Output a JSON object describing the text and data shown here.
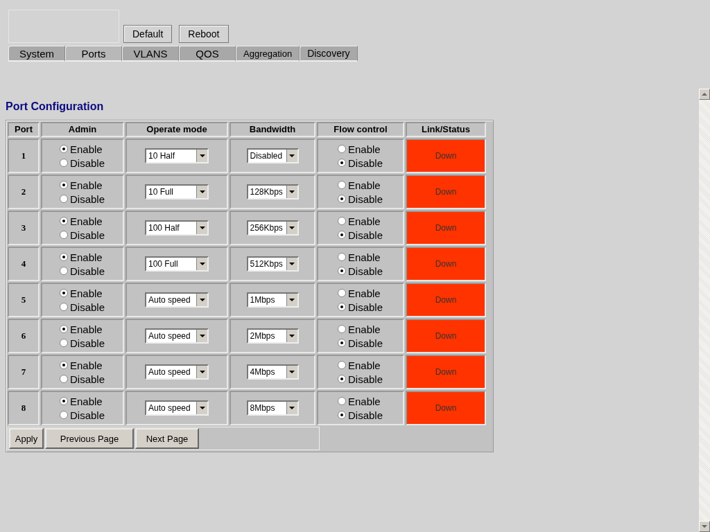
{
  "header": {
    "buttons": [
      "Default",
      "Reboot"
    ]
  },
  "tabs": [
    {
      "label": "System",
      "selected": false,
      "kind": "large"
    },
    {
      "label": "Ports",
      "selected": true,
      "kind": "large"
    },
    {
      "label": "VLANS",
      "selected": false,
      "kind": "large"
    },
    {
      "label": "QOS",
      "selected": false,
      "kind": "large"
    },
    {
      "label": "Aggregation",
      "selected": false,
      "kind": "small"
    },
    {
      "label": "Discovery",
      "selected": false,
      "kind": "medium"
    }
  ],
  "title": "Port Configuration",
  "table": {
    "columns": [
      "Port",
      "Admin",
      "Operate mode",
      "Bandwidth",
      "Flow control",
      "Link/Status"
    ],
    "rows": [
      {
        "port": "1",
        "admin": [
          {
            "label": "Enable",
            "selected": true
          },
          {
            "label": "Disable",
            "selected": false
          }
        ],
        "operate_mode": "10 Half",
        "bandwidth": "Disabled",
        "flow_control": [
          {
            "label": "Enable",
            "selected": false
          },
          {
            "label": "Disable",
            "selected": true
          }
        ],
        "link_status": "Down",
        "color": "#ff3300"
      },
      {
        "port": "2",
        "admin": [
          {
            "label": "Enable",
            "selected": true
          },
          {
            "label": "Disable",
            "selected": false
          }
        ],
        "operate_mode": "10 Full",
        "bandwidth": "128Kbps",
        "flow_control": [
          {
            "label": "Enable",
            "selected": false
          },
          {
            "label": "Disable",
            "selected": true
          }
        ],
        "link_status": "Down",
        "color": "#ff3300"
      },
      {
        "port": "3",
        "admin": [
          {
            "label": "Enable",
            "selected": true
          },
          {
            "label": "Disable",
            "selected": false
          }
        ],
        "operate_mode": "100 Half",
        "bandwidth": "256Kbps",
        "flow_control": [
          {
            "label": "Enable",
            "selected": false
          },
          {
            "label": "Disable",
            "selected": true
          }
        ],
        "link_status": "Down",
        "color": "#ff3300"
      },
      {
        "port": "4",
        "admin": [
          {
            "label": "Enable",
            "selected": true
          },
          {
            "label": "Disable",
            "selected": false
          }
        ],
        "operate_mode": "100 Full",
        "bandwidth": "512Kbps",
        "flow_control": [
          {
            "label": "Enable",
            "selected": false
          },
          {
            "label": "Disable",
            "selected": true
          }
        ],
        "link_status": "Down",
        "color": "#ff3300"
      },
      {
        "port": "5",
        "admin": [
          {
            "label": "Enable",
            "selected": true
          },
          {
            "label": "Disable",
            "selected": false
          }
        ],
        "operate_mode": "Auto speed",
        "bandwidth": "1Mbps",
        "flow_control": [
          {
            "label": "Enable",
            "selected": false
          },
          {
            "label": "Disable",
            "selected": true
          }
        ],
        "link_status": "Down",
        "color": "#ff3300"
      },
      {
        "port": "6",
        "admin": [
          {
            "label": "Enable",
            "selected": true
          },
          {
            "label": "Disable",
            "selected": false
          }
        ],
        "operate_mode": "Auto speed",
        "bandwidth": "2Mbps",
        "flow_control": [
          {
            "label": "Enable",
            "selected": false
          },
          {
            "label": "Disable",
            "selected": true
          }
        ],
        "link_status": "Down",
        "color": "#ff3300"
      },
      {
        "port": "7",
        "admin": [
          {
            "label": "Enable",
            "selected": true
          },
          {
            "label": "Disable",
            "selected": false
          }
        ],
        "operate_mode": "Auto speed",
        "bandwidth": "4Mbps",
        "flow_control": [
          {
            "label": "Enable",
            "selected": false
          },
          {
            "label": "Disable",
            "selected": true
          }
        ],
        "link_status": "Down",
        "color": "#ff3300"
      },
      {
        "port": "8",
        "admin": [
          {
            "label": "Enable",
            "selected": true
          },
          {
            "label": "Disable",
            "selected": false
          }
        ],
        "operate_mode": "Auto speed",
        "bandwidth": "8Mbps",
        "flow_control": [
          {
            "label": "Enable",
            "selected": false
          },
          {
            "label": "Disable",
            "selected": true
          }
        ],
        "link_status": "Down",
        "color": "#ff3300"
      }
    ]
  },
  "footer_buttons": [
    "Apply",
    "Previous Page",
    "Next Page"
  ]
}
